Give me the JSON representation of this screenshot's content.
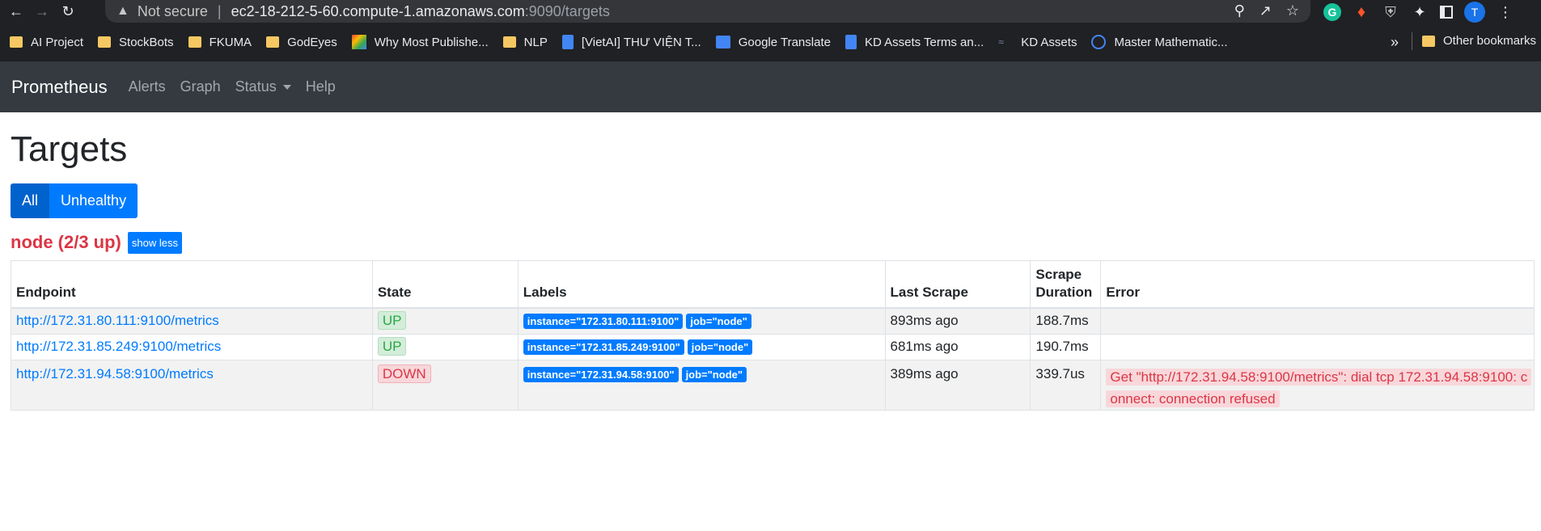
{
  "browser": {
    "not_secure": "Not secure",
    "url_host": "ec2-18-212-5-60.compute-1.amazonaws.com",
    "url_rest": ":9090/targets",
    "profile_initial": "T"
  },
  "bookmarks": [
    {
      "label": "AI Project",
      "icon": "folder"
    },
    {
      "label": "StockBots",
      "icon": "folder"
    },
    {
      "label": "FKUMA",
      "icon": "folder"
    },
    {
      "label": "GodEyes",
      "icon": "folder"
    },
    {
      "label": "Why Most Publishe...",
      "icon": "img"
    },
    {
      "label": "NLP",
      "icon": "folder"
    },
    {
      "label": "[VietAI] THƯ VIỆN T...",
      "icon": "doc"
    },
    {
      "label": "Google Translate",
      "icon": "gt"
    },
    {
      "label": "KD Assets Terms an...",
      "icon": "doc"
    },
    {
      "label": "KD Assets",
      "icon": "kd"
    },
    {
      "label": "Master Mathematic...",
      "icon": "circle"
    }
  ],
  "bookmarks_more": "»",
  "bookmarks_other": "Other bookmarks",
  "navbar": {
    "brand": "Prometheus",
    "links": [
      "Alerts",
      "Graph",
      "Status",
      "Help"
    ]
  },
  "page": {
    "title": "Targets",
    "filters": [
      "All",
      "Unhealthy"
    ],
    "pool_title": "node (2/3 up)",
    "show_less": "show less"
  },
  "table": {
    "headers": {
      "endpoint": "Endpoint",
      "state": "State",
      "labels": "Labels",
      "last_scrape": "Last Scrape",
      "scrape_line1": "Scrape",
      "scrape_line2": "Duration",
      "error": "Error"
    },
    "rows": [
      {
        "endpoint": "http://172.31.80.111:9100/metrics",
        "state": "UP",
        "label_instance": "instance=\"172.31.80.111:9100\"",
        "label_job": "job=\"node\"",
        "last_scrape": "893ms ago",
        "duration": "188.7ms",
        "error": ""
      },
      {
        "endpoint": "http://172.31.85.249:9100/metrics",
        "state": "UP",
        "label_instance": "instance=\"172.31.85.249:9100\"",
        "label_job": "job=\"node\"",
        "last_scrape": "681ms ago",
        "duration": "190.7ms",
        "error": ""
      },
      {
        "endpoint": "http://172.31.94.58:9100/metrics",
        "state": "DOWN",
        "label_instance": "instance=\"172.31.94.58:9100\"",
        "label_job": "job=\"node\"",
        "last_scrape": "389ms ago",
        "duration": "339.7us",
        "error": "Get \"http://172.31.94.58:9100/metrics\": dial tcp 172.31.94.58:9100: connect: connection refused"
      }
    ]
  },
  "colors": {
    "navbar": "#343a40",
    "primary": "#007bff",
    "danger": "#dc3545",
    "success": "#28a745"
  }
}
